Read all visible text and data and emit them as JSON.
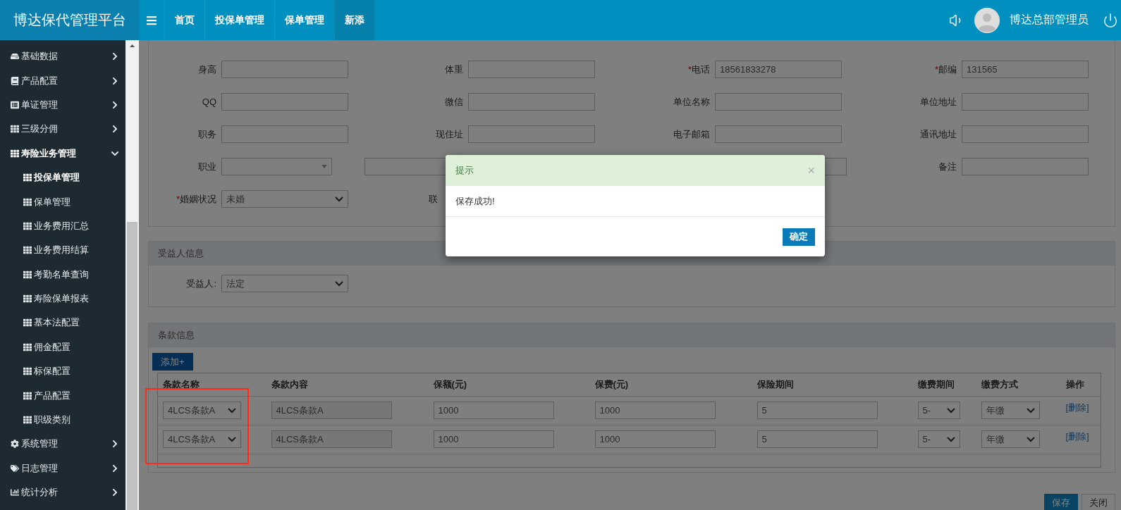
{
  "header": {
    "brand": "博达保代管理平台",
    "nav": [
      {
        "label": "首页",
        "selected": false
      },
      {
        "label": "投保单管理",
        "selected": false
      },
      {
        "label": "保单管理",
        "selected": false
      },
      {
        "label": "新添",
        "selected": true
      }
    ],
    "user": "博达总部管理员"
  },
  "sidebar": {
    "items": [
      {
        "label": "基础数据",
        "expanded": false
      },
      {
        "label": "产品配置",
        "expanded": false
      },
      {
        "label": "单证管理",
        "expanded": false
      },
      {
        "label": "三级分佣",
        "expanded": false
      },
      {
        "label": "寿险业务管理",
        "expanded": true,
        "children": [
          {
            "label": "投保单管理",
            "selected": true
          },
          {
            "label": "保单管理",
            "selected": false
          },
          {
            "label": "业务费用汇总",
            "selected": false
          },
          {
            "label": "业务费用结算",
            "selected": false
          },
          {
            "label": "考勤名单查询",
            "selected": false
          },
          {
            "label": "寿险保单报表",
            "selected": false
          },
          {
            "label": "基本法配置",
            "selected": false
          },
          {
            "label": "佣金配置",
            "selected": false
          },
          {
            "label": "标保配置",
            "selected": false
          },
          {
            "label": "产品配置",
            "selected": false
          },
          {
            "label": "职级类别",
            "selected": false
          }
        ]
      },
      {
        "label": "系统管理",
        "expanded": false
      },
      {
        "label": "日志管理",
        "expanded": false
      },
      {
        "label": "统计分析",
        "expanded": false
      }
    ]
  },
  "form": {
    "rows": [
      [
        {
          "kind": "input",
          "label": "身高"
        },
        {
          "kind": "input",
          "label": "体重"
        },
        {
          "kind": "input",
          "label": "电话",
          "required_mark": "*",
          "value": "18561833278"
        },
        {
          "kind": "input",
          "label": "邮编",
          "required_mark": "*",
          "value": "131565"
        }
      ],
      [
        {
          "kind": "input",
          "label": "QQ"
        },
        {
          "kind": "input",
          "label": "微信"
        },
        {
          "kind": "input",
          "label": "单位名称"
        },
        {
          "kind": "input",
          "label": "单位地址"
        }
      ],
      [
        {
          "kind": "input",
          "label": "职务"
        },
        {
          "kind": "input",
          "label": "现住址"
        },
        {
          "kind": "input",
          "label": "电子邮箱"
        },
        {
          "kind": "input",
          "label": "通讯地址"
        }
      ],
      [
        {
          "kind": "dropdown",
          "label": "职业"
        },
        {
          "kind": "wide"
        },
        {
          "kind": "bare"
        },
        {
          "kind": "input",
          "label": "备注"
        }
      ],
      [
        {
          "kind": "select",
          "label": "婚姻状况",
          "required_mark": "*",
          "value": "未婚"
        },
        {
          "kind": "partial",
          "label": "联"
        }
      ]
    ]
  },
  "beneficiary": {
    "title": "受益人信息",
    "label": "受益人:",
    "value": "法定"
  },
  "clauses": {
    "title": "条款信息",
    "add_button": "添加+",
    "columns": [
      "条款名称",
      "条款内容",
      "保额(元)",
      "保费(元)",
      "保险期间",
      "缴费期间",
      "缴费方式",
      "操作"
    ],
    "rows": [
      {
        "name": "4LCS条款A",
        "content": "4LCS条款A",
        "amount": "1000",
        "premium": "1000",
        "period": "5",
        "pay_period": "5-",
        "pay_method": "年缴",
        "action": "[删除]"
      },
      {
        "name": "4LCS条款A",
        "content": "4LCS条款A",
        "amount": "1000",
        "premium": "1000",
        "period": "5",
        "pay_period": "5-",
        "pay_method": "年缴",
        "action": "[删除]"
      }
    ]
  },
  "footer_buttons": [
    {
      "label": "保存",
      "primary": true
    },
    {
      "label": "关闭",
      "primary": false
    }
  ],
  "modal": {
    "title": "提示",
    "close": "×",
    "message": "保存成功!",
    "button": "确定"
  }
}
